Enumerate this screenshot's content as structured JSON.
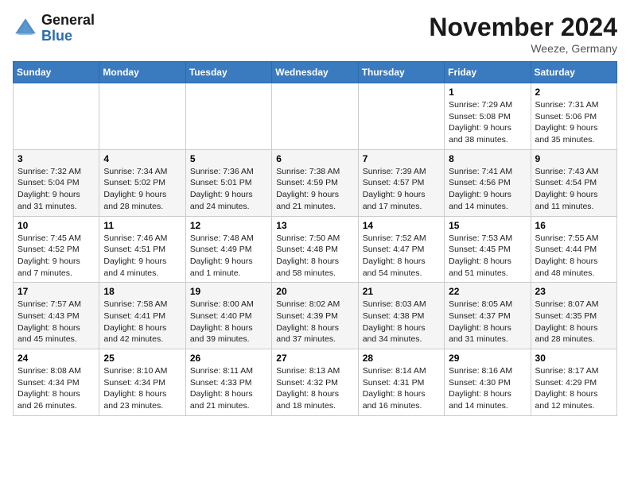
{
  "header": {
    "logo_general": "General",
    "logo_blue": "Blue",
    "month_title": "November 2024",
    "location": "Weeze, Germany"
  },
  "weekdays": [
    "Sunday",
    "Monday",
    "Tuesday",
    "Wednesday",
    "Thursday",
    "Friday",
    "Saturday"
  ],
  "weeks": [
    [
      {
        "day": "",
        "info": ""
      },
      {
        "day": "",
        "info": ""
      },
      {
        "day": "",
        "info": ""
      },
      {
        "day": "",
        "info": ""
      },
      {
        "day": "",
        "info": ""
      },
      {
        "day": "1",
        "info": "Sunrise: 7:29 AM\nSunset: 5:08 PM\nDaylight: 9 hours\nand 38 minutes."
      },
      {
        "day": "2",
        "info": "Sunrise: 7:31 AM\nSunset: 5:06 PM\nDaylight: 9 hours\nand 35 minutes."
      }
    ],
    [
      {
        "day": "3",
        "info": "Sunrise: 7:32 AM\nSunset: 5:04 PM\nDaylight: 9 hours\nand 31 minutes."
      },
      {
        "day": "4",
        "info": "Sunrise: 7:34 AM\nSunset: 5:02 PM\nDaylight: 9 hours\nand 28 minutes."
      },
      {
        "day": "5",
        "info": "Sunrise: 7:36 AM\nSunset: 5:01 PM\nDaylight: 9 hours\nand 24 minutes."
      },
      {
        "day": "6",
        "info": "Sunrise: 7:38 AM\nSunset: 4:59 PM\nDaylight: 9 hours\nand 21 minutes."
      },
      {
        "day": "7",
        "info": "Sunrise: 7:39 AM\nSunset: 4:57 PM\nDaylight: 9 hours\nand 17 minutes."
      },
      {
        "day": "8",
        "info": "Sunrise: 7:41 AM\nSunset: 4:56 PM\nDaylight: 9 hours\nand 14 minutes."
      },
      {
        "day": "9",
        "info": "Sunrise: 7:43 AM\nSunset: 4:54 PM\nDaylight: 9 hours\nand 11 minutes."
      }
    ],
    [
      {
        "day": "10",
        "info": "Sunrise: 7:45 AM\nSunset: 4:52 PM\nDaylight: 9 hours\nand 7 minutes."
      },
      {
        "day": "11",
        "info": "Sunrise: 7:46 AM\nSunset: 4:51 PM\nDaylight: 9 hours\nand 4 minutes."
      },
      {
        "day": "12",
        "info": "Sunrise: 7:48 AM\nSunset: 4:49 PM\nDaylight: 9 hours\nand 1 minute."
      },
      {
        "day": "13",
        "info": "Sunrise: 7:50 AM\nSunset: 4:48 PM\nDaylight: 8 hours\nand 58 minutes."
      },
      {
        "day": "14",
        "info": "Sunrise: 7:52 AM\nSunset: 4:47 PM\nDaylight: 8 hours\nand 54 minutes."
      },
      {
        "day": "15",
        "info": "Sunrise: 7:53 AM\nSunset: 4:45 PM\nDaylight: 8 hours\nand 51 minutes."
      },
      {
        "day": "16",
        "info": "Sunrise: 7:55 AM\nSunset: 4:44 PM\nDaylight: 8 hours\nand 48 minutes."
      }
    ],
    [
      {
        "day": "17",
        "info": "Sunrise: 7:57 AM\nSunset: 4:43 PM\nDaylight: 8 hours\nand 45 minutes."
      },
      {
        "day": "18",
        "info": "Sunrise: 7:58 AM\nSunset: 4:41 PM\nDaylight: 8 hours\nand 42 minutes."
      },
      {
        "day": "19",
        "info": "Sunrise: 8:00 AM\nSunset: 4:40 PM\nDaylight: 8 hours\nand 39 minutes."
      },
      {
        "day": "20",
        "info": "Sunrise: 8:02 AM\nSunset: 4:39 PM\nDaylight: 8 hours\nand 37 minutes."
      },
      {
        "day": "21",
        "info": "Sunrise: 8:03 AM\nSunset: 4:38 PM\nDaylight: 8 hours\nand 34 minutes."
      },
      {
        "day": "22",
        "info": "Sunrise: 8:05 AM\nSunset: 4:37 PM\nDaylight: 8 hours\nand 31 minutes."
      },
      {
        "day": "23",
        "info": "Sunrise: 8:07 AM\nSunset: 4:35 PM\nDaylight: 8 hours\nand 28 minutes."
      }
    ],
    [
      {
        "day": "24",
        "info": "Sunrise: 8:08 AM\nSunset: 4:34 PM\nDaylight: 8 hours\nand 26 minutes."
      },
      {
        "day": "25",
        "info": "Sunrise: 8:10 AM\nSunset: 4:34 PM\nDaylight: 8 hours\nand 23 minutes."
      },
      {
        "day": "26",
        "info": "Sunrise: 8:11 AM\nSunset: 4:33 PM\nDaylight: 8 hours\nand 21 minutes."
      },
      {
        "day": "27",
        "info": "Sunrise: 8:13 AM\nSunset: 4:32 PM\nDaylight: 8 hours\nand 18 minutes."
      },
      {
        "day": "28",
        "info": "Sunrise: 8:14 AM\nSunset: 4:31 PM\nDaylight: 8 hours\nand 16 minutes."
      },
      {
        "day": "29",
        "info": "Sunrise: 8:16 AM\nSunset: 4:30 PM\nDaylight: 8 hours\nand 14 minutes."
      },
      {
        "day": "30",
        "info": "Sunrise: 8:17 AM\nSunset: 4:29 PM\nDaylight: 8 hours\nand 12 minutes."
      }
    ]
  ]
}
